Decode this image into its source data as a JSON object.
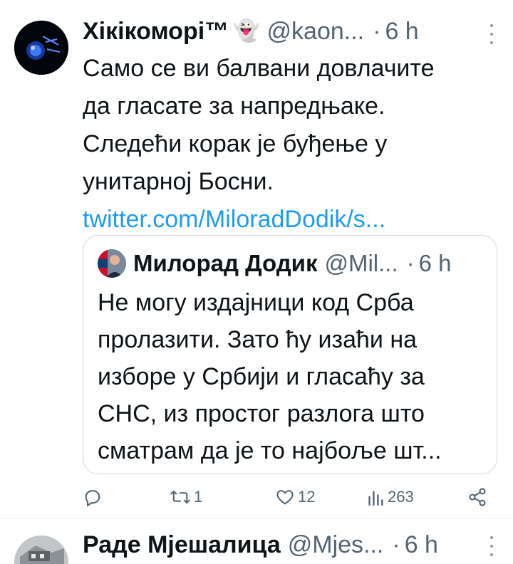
{
  "tweet": {
    "author_name": "Хікікоморі™",
    "author_emoji": "👻",
    "handle": "@kaon...",
    "separator": "·",
    "time": "6 h",
    "body_lines": [
      "Само се ви балвани довлачите",
      "да гласате за напредњаке.",
      "Следећи корак је буђење у",
      "унитарној Босни."
    ],
    "link": "twitter.com/MiloradDodik/s...",
    "quote": {
      "author_name": "Милорад Додик",
      "handle": "@Mil...",
      "separator": "·",
      "time": "6 h",
      "body_lines": [
        "Не могу издајници код Срба",
        "пролазити. Зато ћу изаћи на",
        "изборе у Србији и гласаћу за",
        "СНС, из простог разлога што",
        "сматрам да је то најбоље шт..."
      ]
    },
    "actions": {
      "reply_icon": "reply-icon",
      "retweet_icon": "retweet-icon",
      "retweet_count": "1",
      "like_icon": "heart-icon",
      "like_count": "12",
      "views_icon": "views-chart-icon",
      "views_count": "263",
      "share_icon": "share-icon"
    }
  },
  "next_tweet": {
    "author_name": "Раде Мјешалица",
    "handle": "@Mjes...",
    "separator": "·",
    "time": "6 h"
  },
  "colors": {
    "link": "#1d9bf0",
    "secondary_text": "#536471",
    "border": "#cfd9de"
  }
}
